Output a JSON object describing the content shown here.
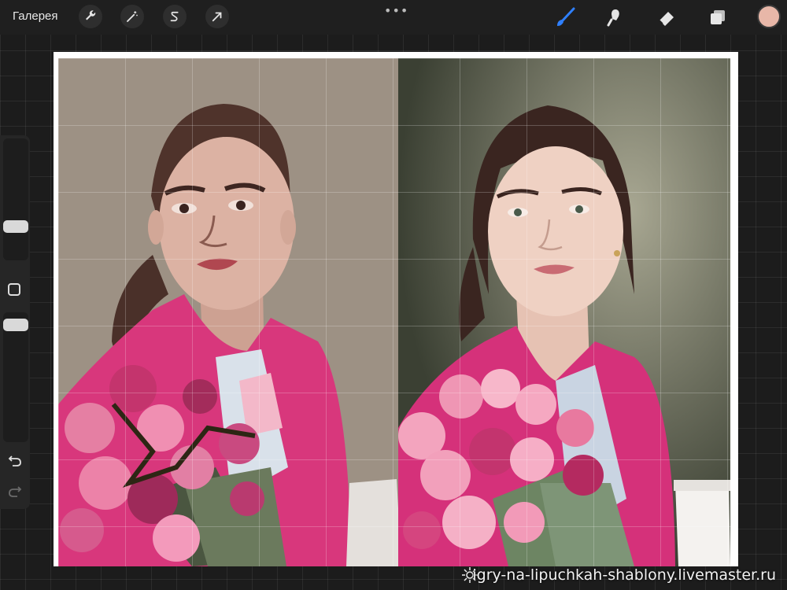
{
  "toolbar": {
    "gallery_label": "Галерея",
    "more_dots": "•••",
    "left_tools": [
      "wrench-icon",
      "magic-wand-icon",
      "selection-icon",
      "transform-arrow-icon"
    ],
    "right_tools": [
      "brush-icon",
      "smudge-icon",
      "eraser-icon",
      "layers-icon"
    ],
    "active_color": "#e8b7a8"
  },
  "sidebar": {
    "brush_size_level": 0.25,
    "opacity_level": 0.95
  },
  "canvas": {
    "left_panel": "painting",
    "right_panel": "photo reference"
  },
  "watermark": {
    "text": "igry-na-lipuchkah-shablony.livemaster.ru"
  }
}
